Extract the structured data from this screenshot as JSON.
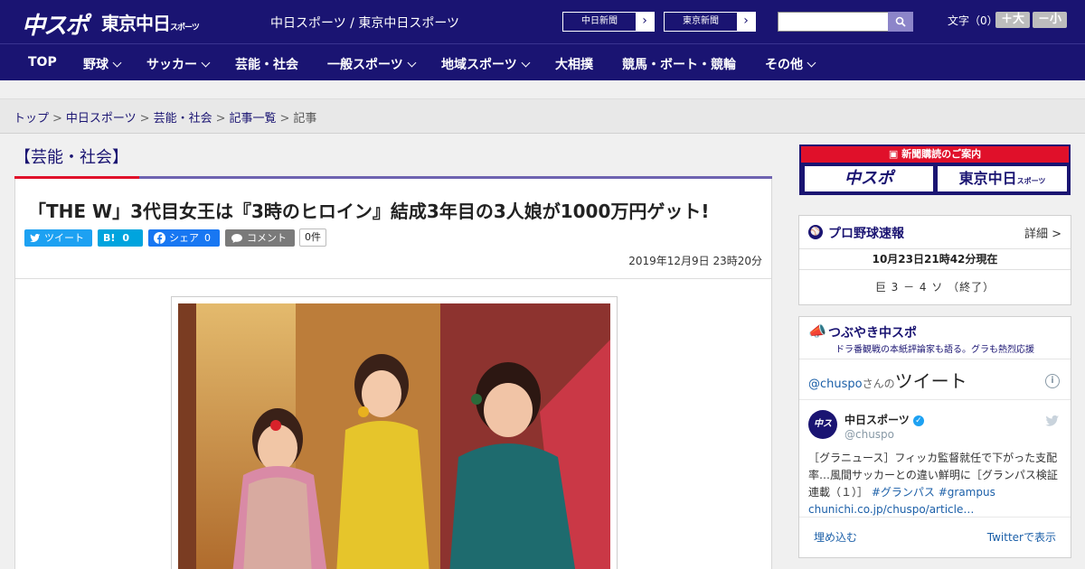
{
  "header": {
    "logo_main": "中スポ",
    "logo_sub": "東京中日",
    "logo_sub_small": "スポーツ",
    "tagline": "中日スポーツ / 東京中日スポーツ",
    "paper_links": [
      {
        "label": "中日新聞"
      },
      {
        "label": "東京新聞"
      }
    ],
    "search_placeholder": "",
    "font_size_label": "文字（0）",
    "font_larger": "＋大",
    "font_smaller": "－小"
  },
  "nav": {
    "items": [
      {
        "label": "TOP",
        "has_menu": false
      },
      {
        "label": "野球",
        "has_menu": true
      },
      {
        "label": "サッカー",
        "has_menu": true
      },
      {
        "label": "芸能・社会",
        "has_menu": false
      },
      {
        "label": "一般スポーツ",
        "has_menu": true
      },
      {
        "label": "地域スポーツ",
        "has_menu": true
      },
      {
        "label": "大相撲",
        "has_menu": false
      },
      {
        "label": "競馬・ボート・競輪",
        "has_menu": false
      },
      {
        "label": "その他",
        "has_menu": true
      }
    ]
  },
  "breadcrumb": {
    "items": [
      "トップ",
      "中日スポーツ",
      "芸能・社会",
      "記事一覧"
    ],
    "current": "記事"
  },
  "article": {
    "category": "【芸能・社会】",
    "headline": "「THE W」3代目女王は『3時のヒロイン』結成3年目の3人娘が1000万円ゲット!",
    "share": {
      "tweet": "ツイート",
      "hatena": "B!",
      "hatena_count": "0",
      "facebook": "シェア",
      "facebook_count": "0",
      "comment": "コメント",
      "comment_count": "0件"
    },
    "date": "2019年12月9日 23時20分"
  },
  "sidebar": {
    "promo": {
      "title": "新聞購読のご案内",
      "left": "中スポ",
      "right": "東京中日",
      "right_small": "スポーツ"
    },
    "baseball": {
      "title": "プロ野球速報",
      "detail_link": "詳細 >",
      "timestamp": "10月23日21時42分現在",
      "score": "巨 3 － 4 ソ （終了）"
    },
    "tsubuyaki": {
      "title": "つぶやき中スポ",
      "subtitle": "ドラ番観戦の本紙評論家も語る。グラも熱烈応援",
      "handle_link": "@chuspo",
      "handle_suffix": "さんの",
      "tweets_heading": "ツイート",
      "account_name": "中日スポーツ",
      "account_handle": "@chuspo",
      "tweet_text": "［グラニュース］フィッカ監督就任で下がった支配率…風間サッカーとの違い鮮明に［グランパス検証連載（１）］",
      "tweet_hashtags": "#グランパス #grampus",
      "tweet_link": "chunichi.co.jp/chuspo/article…",
      "embed_link": "埋め込む",
      "view_on_twitter": "Twitterで表示"
    }
  },
  "colors": {
    "brand_navy": "#1a1472",
    "accent_red": "#e0102a",
    "twitter_blue": "#1da1f2",
    "hatena_blue": "#00a4de",
    "facebook_blue": "#1877f2",
    "comment_gray": "#7a7a7a"
  }
}
